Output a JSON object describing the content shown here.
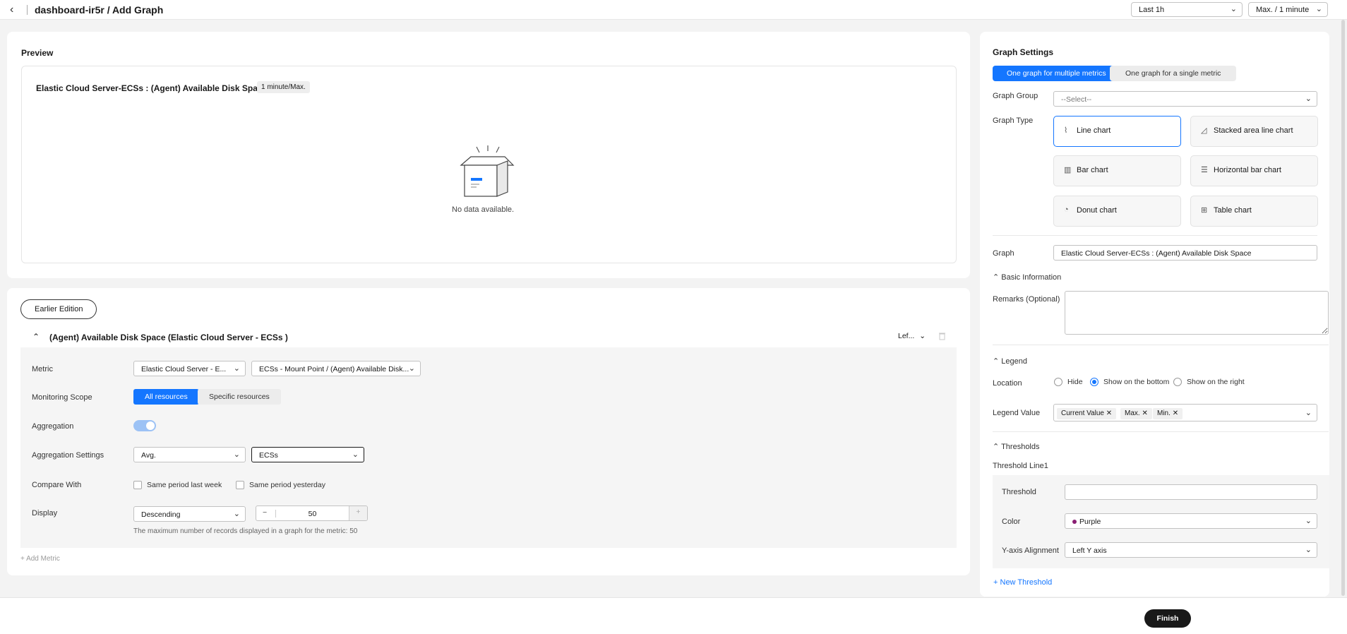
{
  "header": {
    "back_icon": "chevron-left-icon",
    "title": "dashboard-ir5r / Add Graph",
    "time_range": "Last 1h",
    "aggregation_period": "Max. / 1 minute"
  },
  "preview": {
    "heading": "Preview",
    "graph_title": "Elastic Cloud Server-ECSs : (Agent) Available Disk Space",
    "period_badge": "1 minute/Max.",
    "empty_text": "No data available."
  },
  "metric_panel": {
    "earlier_edition": "Earlier Edition",
    "metric_title": "(Agent) Available Disk Space (Elastic Cloud Server - ECSs )",
    "axis_select": "Lef...",
    "rows": {
      "metric_label": "Metric",
      "metric_service": "Elastic Cloud Server - E...",
      "metric_name": "ECSs - Mount Point / (Agent) Available Disk...",
      "scope_label": "Monitoring Scope",
      "scope_all": "All resources",
      "scope_specific": "Specific resources",
      "aggregation_label": "Aggregation",
      "agg_settings_label": "Aggregation Settings",
      "agg_method": "Avg.",
      "agg_dimension": "ECSs",
      "compare_label": "Compare With",
      "compare_week": "Same period last week",
      "compare_yesterday": "Same period yesterday",
      "display_label": "Display",
      "display_order": "Descending",
      "display_count": "50",
      "display_hint": "The maximum number of records displayed in a graph for the metric: 50"
    },
    "add_metric": "Add Metric"
  },
  "settings": {
    "heading": "Graph Settings",
    "mode_multi": "One graph for multiple metrics",
    "mode_single": "One graph for a single metric",
    "graph_group_label": "Graph Group",
    "graph_group_placeholder": "--Select--",
    "graph_type_label": "Graph Type",
    "types": {
      "line": "Line chart",
      "stacked": "Stacked area line chart",
      "bar": "Bar chart",
      "hbar": "Horizontal bar chart",
      "donut": "Donut chart",
      "table": "Table chart"
    },
    "graph_label": "Graph",
    "graph_value": "Elastic Cloud Server-ECSs : (Agent) Available Disk Space",
    "basic_info": "Basic Information",
    "remarks_label": "Remarks (Optional)",
    "legend": "Legend",
    "location_label": "Location",
    "loc_hide": "Hide",
    "loc_bottom": "Show on the bottom",
    "loc_right": "Show on the right",
    "legend_value_label": "Legend Value",
    "legend_tags": [
      "Current Value",
      "Max.",
      "Min."
    ],
    "thresholds": "Thresholds",
    "threshold_line": "Threshold Line1",
    "threshold_label": "Threshold",
    "threshold_value": "",
    "color_label": "Color",
    "color_value": "Purple",
    "color_hex": "#8a1f73",
    "yaxis_label": "Y-axis Alignment",
    "yaxis_value": "Left Y axis",
    "new_threshold": "New Threshold"
  },
  "footer": {
    "finish": "Finish"
  },
  "colors": {
    "accent": "#1476ff",
    "finish_bg": "#191919"
  }
}
